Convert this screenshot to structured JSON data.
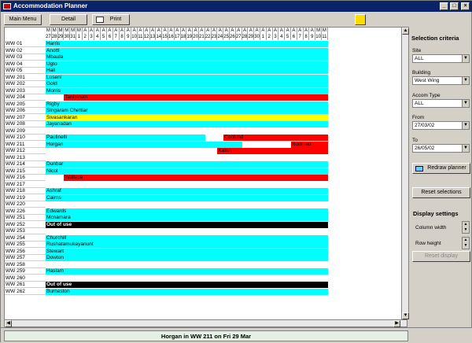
{
  "app": {
    "title": "Accommodation Planner"
  },
  "toolbar": {
    "main_menu": "Main Menu",
    "detail": "Detail",
    "print": "Print"
  },
  "grid": {
    "header_letters": [
      "M",
      "M",
      "M",
      "M",
      "M",
      "M",
      "A",
      "A",
      "A",
      "A",
      "A",
      "A",
      "A",
      "A",
      "A",
      "A",
      "A",
      "A",
      "A",
      "A",
      "A",
      "A",
      "A",
      "A",
      "A",
      "A",
      "A",
      "A",
      "A",
      "A",
      "A",
      "A",
      "A",
      "A",
      "A",
      "A",
      "A",
      "A",
      "A",
      "A",
      "A",
      "A",
      "A",
      "A",
      "M",
      "M",
      "M",
      "M",
      "M",
      "M",
      "M",
      "M",
      "M",
      "M",
      "M"
    ],
    "header_days": [
      "27",
      "28",
      "29",
      "30",
      "31",
      "1",
      "2",
      "3",
      "4",
      "5",
      "6",
      "7",
      "8",
      "9",
      "10",
      "11",
      "12",
      "13",
      "14",
      "15",
      "16",
      "17",
      "18",
      "19",
      "20",
      "21",
      "22",
      "23",
      "24",
      "25",
      "26",
      "27",
      "28",
      "29",
      "30",
      "1",
      "2",
      "3",
      "4",
      "5",
      "6",
      "7",
      "8",
      "9",
      "10",
      "11"
    ],
    "rows": [
      {
        "room": "WW 01",
        "segments": [
          {
            "start": 0,
            "end": 59,
            "color": "#00ffff",
            "label": "Harris"
          }
        ]
      },
      {
        "room": "WW 02",
        "segments": [
          {
            "start": 0,
            "end": 59,
            "color": "#00ffff",
            "label": "Anotti"
          }
        ]
      },
      {
        "room": "WW 03",
        "segments": [
          {
            "start": 0,
            "end": 59,
            "color": "#00ffff",
            "label": "Mbaula"
          }
        ]
      },
      {
        "room": "WW 04",
        "segments": [
          {
            "start": 0,
            "end": 59,
            "color": "#00ffff",
            "label": "Ugto"
          }
        ]
      },
      {
        "room": "WW 05",
        "segments": [
          {
            "start": 0,
            "end": 59,
            "color": "#00ffff",
            "label": "Hall"
          }
        ]
      },
      {
        "room": "WW 201",
        "segments": [
          {
            "start": 0,
            "end": 59,
            "color": "#00ffff",
            "label": "Luseni"
          }
        ]
      },
      {
        "room": "WW 202",
        "segments": [
          {
            "start": 0,
            "end": 59,
            "color": "#00ffff",
            "label": "Gold"
          }
        ]
      },
      {
        "room": "WW 203",
        "segments": [
          {
            "start": 0,
            "end": 59,
            "color": "#00ffff",
            "label": "Morris"
          }
        ]
      },
      {
        "room": "WW 204",
        "segments": [
          {
            "start": 0,
            "end": 3,
            "color": "#ffffff",
            "label": ""
          },
          {
            "start": 3,
            "end": 59,
            "color": "#ff0000",
            "label": "Tanberum"
          }
        ]
      },
      {
        "room": "WW 205",
        "segments": [
          {
            "start": 0,
            "end": 59,
            "color": "#00ffff",
            "label": "Rigby"
          }
        ]
      },
      {
        "room": "WW 206",
        "segments": [
          {
            "start": 0,
            "end": 59,
            "color": "#00ffff",
            "label": "Singaram Chettiar"
          }
        ]
      },
      {
        "room": "WW 207",
        "segments": [
          {
            "start": 0,
            "end": 59,
            "color": "#ffff00",
            "label": "Sivasankaran"
          }
        ]
      },
      {
        "room": "WW 208",
        "segments": [
          {
            "start": 0,
            "end": 59,
            "color": "#00ffff",
            "label": "Jayanadan"
          }
        ]
      },
      {
        "room": "WW 209",
        "segments": [
          {
            "start": 0,
            "end": 59,
            "color": "#ffffff",
            "label": ""
          }
        ]
      },
      {
        "room": "WW 210",
        "segments": [
          {
            "start": 0,
            "end": 26,
            "color": "#00ffff",
            "label": "Paulinelli"
          },
          {
            "start": 26,
            "end": 29,
            "color": "#ffffff",
            "label": ""
          },
          {
            "start": 29,
            "end": 50,
            "color": "#ff0000",
            "label": "Conlund"
          },
          {
            "start": 50,
            "end": 59,
            "color": "#ffffff",
            "label": ""
          }
        ]
      },
      {
        "room": "WW 211",
        "segments": [
          {
            "start": 0,
            "end": 32,
            "color": "#00ffff",
            "label": "Horgan"
          },
          {
            "start": 32,
            "end": 40,
            "color": "#ffffff",
            "label": ""
          },
          {
            "start": 40,
            "end": 53,
            "color": "#ff0000",
            "label": "Rodman"
          },
          {
            "start": 53,
            "end": 59,
            "color": "#ffffff",
            "label": ""
          }
        ]
      },
      {
        "room": "WW 212",
        "segments": [
          {
            "start": 0,
            "end": 28,
            "color": "#ffffff",
            "label": ""
          },
          {
            "start": 28,
            "end": 54,
            "color": "#ff0000",
            "label": "Kalan"
          },
          {
            "start": 54,
            "end": 59,
            "color": "#ffffff",
            "label": ""
          }
        ]
      },
      {
        "room": "WW 213",
        "segments": [
          {
            "start": 0,
            "end": 59,
            "color": "#ffffff",
            "label": ""
          }
        ]
      },
      {
        "room": "WW 214",
        "segments": [
          {
            "start": 0,
            "end": 59,
            "color": "#00ffff",
            "label": "Dunbar"
          }
        ]
      },
      {
        "room": "WW 215",
        "segments": [
          {
            "start": 0,
            "end": 59,
            "color": "#00ffff",
            "label": "Nicol"
          }
        ]
      },
      {
        "room": "WW 216",
        "segments": [
          {
            "start": 0,
            "end": 3,
            "color": "#ffffff",
            "label": ""
          },
          {
            "start": 3,
            "end": 59,
            "color": "#ff0000",
            "label": "Wallace"
          }
        ]
      },
      {
        "room": "WW 217",
        "segments": [
          {
            "start": 0,
            "end": 59,
            "color": "#ffffff",
            "label": ""
          }
        ]
      },
      {
        "room": "WW 218",
        "segments": [
          {
            "start": 0,
            "end": 59,
            "color": "#00ffff",
            "label": "Ashraf"
          }
        ]
      },
      {
        "room": "WW 219",
        "segments": [
          {
            "start": 0,
            "end": 59,
            "color": "#00ffff",
            "label": "Cairns"
          }
        ]
      },
      {
        "room": "WW 220",
        "segments": [
          {
            "start": 0,
            "end": 59,
            "color": "#ffffff",
            "label": ""
          }
        ]
      },
      {
        "room": "WW 226",
        "segments": [
          {
            "start": 0,
            "end": 59,
            "color": "#00ffff",
            "label": "Edwards"
          }
        ]
      },
      {
        "room": "WW 251",
        "segments": [
          {
            "start": 0,
            "end": 59,
            "color": "#00ffff",
            "label": "Mcnamara"
          }
        ]
      },
      {
        "room": "WW 252",
        "segments": [
          {
            "start": 0,
            "end": 59,
            "color": "#000000",
            "label": "Out of use"
          }
        ]
      },
      {
        "room": "WW 253",
        "segments": [
          {
            "start": 0,
            "end": 59,
            "color": "#ffffff",
            "label": ""
          }
        ]
      },
      {
        "room": "WW 254",
        "segments": [
          {
            "start": 0,
            "end": 59,
            "color": "#00ffff",
            "label": "Churchill"
          }
        ]
      },
      {
        "room": "WW 255",
        "segments": [
          {
            "start": 0,
            "end": 59,
            "color": "#00ffff",
            "label": "Rushatamukayanunt"
          }
        ]
      },
      {
        "room": "WW 256",
        "segments": [
          {
            "start": 0,
            "end": 59,
            "color": "#00ffff",
            "label": "Stewart"
          }
        ]
      },
      {
        "room": "WW 257",
        "segments": [
          {
            "start": 0,
            "end": 59,
            "color": "#00ffff",
            "label": "Dowton"
          }
        ]
      },
      {
        "room": "WW 258",
        "segments": [
          {
            "start": 0,
            "end": 59,
            "color": "#ffffff",
            "label": ""
          }
        ]
      },
      {
        "room": "WW 259",
        "segments": [
          {
            "start": 0,
            "end": 59,
            "color": "#00ffff",
            "label": "Haslam"
          }
        ]
      },
      {
        "room": "WW 260",
        "segments": [
          {
            "start": 0,
            "end": 59,
            "color": "#ffffff",
            "label": ""
          }
        ]
      },
      {
        "room": "WW 261",
        "segments": [
          {
            "start": 0,
            "end": 59,
            "color": "#000000",
            "label": "Out of use"
          }
        ]
      },
      {
        "room": "WW 262",
        "segments": [
          {
            "start": 0,
            "end": 59,
            "color": "#00ffff",
            "label": "Burneston"
          }
        ]
      }
    ]
  },
  "panel": {
    "selection_title": "Selection criteria",
    "site_label": "Site",
    "site_value": "ALL",
    "building_label": "Building",
    "building_value": "West Wing",
    "accom_type_label": "Accom Type",
    "accom_type_value": "ALL",
    "from_label": "From",
    "from_value": "27/03/02",
    "to_label": "To",
    "to_value": "26/05/02",
    "redraw_label": "Redraw planner",
    "reset_selections_label": "Reset selections",
    "display_title": "Display settings",
    "column_width_label": "Column width",
    "row_height_label": "Row height",
    "reset_display_label": "Reset display"
  },
  "status": {
    "text": "Horgan in WW 211 on Fri 29 Mar"
  }
}
